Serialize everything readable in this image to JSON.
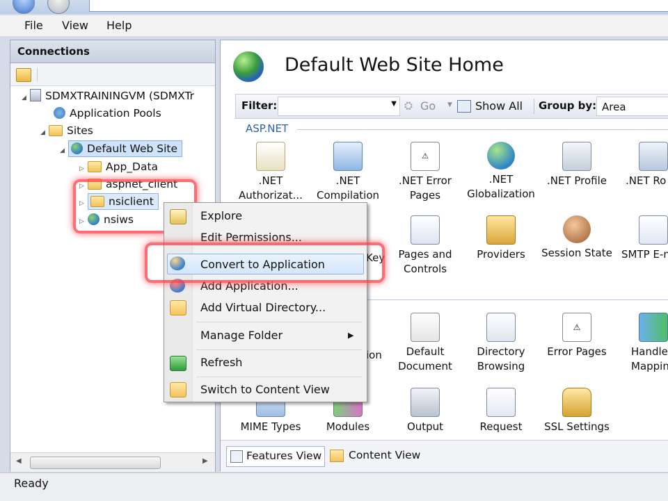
{
  "menu": {
    "items": [
      "File",
      "View",
      "Help"
    ]
  },
  "connections": {
    "title": "Connections",
    "tree": [
      {
        "label": "SDMXTRAININGVM (SDMXTr",
        "icon": "server-icon",
        "level": 1
      },
      {
        "label": "Application Pools",
        "icon": "app-pools-icon",
        "level": 2
      },
      {
        "label": "Sites",
        "icon": "sites-folder-icon",
        "level": 2
      },
      {
        "label": "Default Web Site",
        "icon": "globe-icon",
        "level": 3
      },
      {
        "label": "App_Data",
        "icon": "folder-icon",
        "level": 4
      },
      {
        "label": "aspnet_client",
        "icon": "folder-icon",
        "level": 4
      },
      {
        "label": "nsiclient",
        "icon": "folder-icon",
        "level": 4
      },
      {
        "label": "nsiws",
        "icon": "web-app-icon",
        "level": 4
      }
    ]
  },
  "main": {
    "title": "Default Web Site Home",
    "filter": {
      "label": "Filter:",
      "value": "",
      "go": "Go",
      "show_all": "Show All",
      "group_by_label": "Group by:",
      "group_by_value": "Area"
    },
    "group_aspnet": "ASP.NET",
    "features_row1": [
      {
        "line1": ".NET",
        "line2": "Authorizat...",
        "icon": "lock-document-icon"
      },
      {
        "line1": ".NET",
        "line2": "Compilation",
        "icon": "compilation-icon"
      },
      {
        "line1": ".NET Error",
        "line2": "Pages",
        "icon": "error-404-icon"
      },
      {
        "line1": ".NET",
        "line2": "Globalization",
        "icon": "globe-icon"
      },
      {
        "line1": ".NET Profile",
        "line2": "",
        "icon": "profile-icon"
      },
      {
        "line1": ".NET Ro",
        "line2": "",
        "icon": "roles-icon"
      }
    ],
    "features_row2": [
      {
        "line1": "Key",
        "line2": "",
        "icon": "machine-key-icon"
      },
      {
        "line1": "Pages and",
        "line2": "Controls",
        "icon": "pages-controls-icon"
      },
      {
        "line1": "Providers",
        "line2": "",
        "icon": "providers-icon"
      },
      {
        "line1": "Session State",
        "line2": "",
        "icon": "session-state-icon"
      },
      {
        "line1": "SMTP E-m",
        "line2": "",
        "icon": "smtp-email-icon"
      }
    ],
    "features_row3": [
      {
        "line1": "ion",
        "line2": "",
        "icon": "compression-icon"
      },
      {
        "line1": "Default",
        "line2": "Document",
        "icon": "default-document-icon"
      },
      {
        "line1": "Directory",
        "line2": "Browsing",
        "icon": "directory-browsing-icon"
      },
      {
        "line1": "Error Pages",
        "line2": "",
        "icon": "error-pages-icon"
      },
      {
        "line1": "Handle",
        "line2": "Mappin",
        "icon": "handler-mappings-icon"
      }
    ],
    "features_row4": [
      {
        "line1": "MIME Types",
        "icon": "mime-types-icon"
      },
      {
        "line1": "Modules",
        "icon": "modules-icon"
      },
      {
        "line1": "Output",
        "icon": "output-caching-icon"
      },
      {
        "line1": "Request",
        "icon": "request-filtering-icon"
      },
      {
        "line1": "SSL Settings",
        "icon": "ssl-lock-icon"
      }
    ],
    "tabs": {
      "features_view": "Features View",
      "content_view": "Content View"
    }
  },
  "context_menu": {
    "items": [
      {
        "label": "Explore",
        "icon": "explore-icon"
      },
      {
        "label": "Edit Permissions...",
        "icon": ""
      },
      {
        "label": "Convert to Application",
        "icon": "convert-app-icon"
      },
      {
        "label": "Add Application...",
        "icon": "add-app-icon"
      },
      {
        "label": "Add Virtual Directory...",
        "icon": "add-vdir-icon"
      },
      {
        "label": "Manage Folder",
        "icon": "",
        "submenu": true
      },
      {
        "label": "Refresh",
        "icon": "refresh-icon"
      },
      {
        "label": "Switch to Content View",
        "icon": "content-view-icon"
      }
    ]
  },
  "statusbar": {
    "text": "Ready"
  },
  "colors": {
    "accent": "#3a78c8",
    "highlight_red": "#ff3c46",
    "selection": "#cfe3fb"
  }
}
